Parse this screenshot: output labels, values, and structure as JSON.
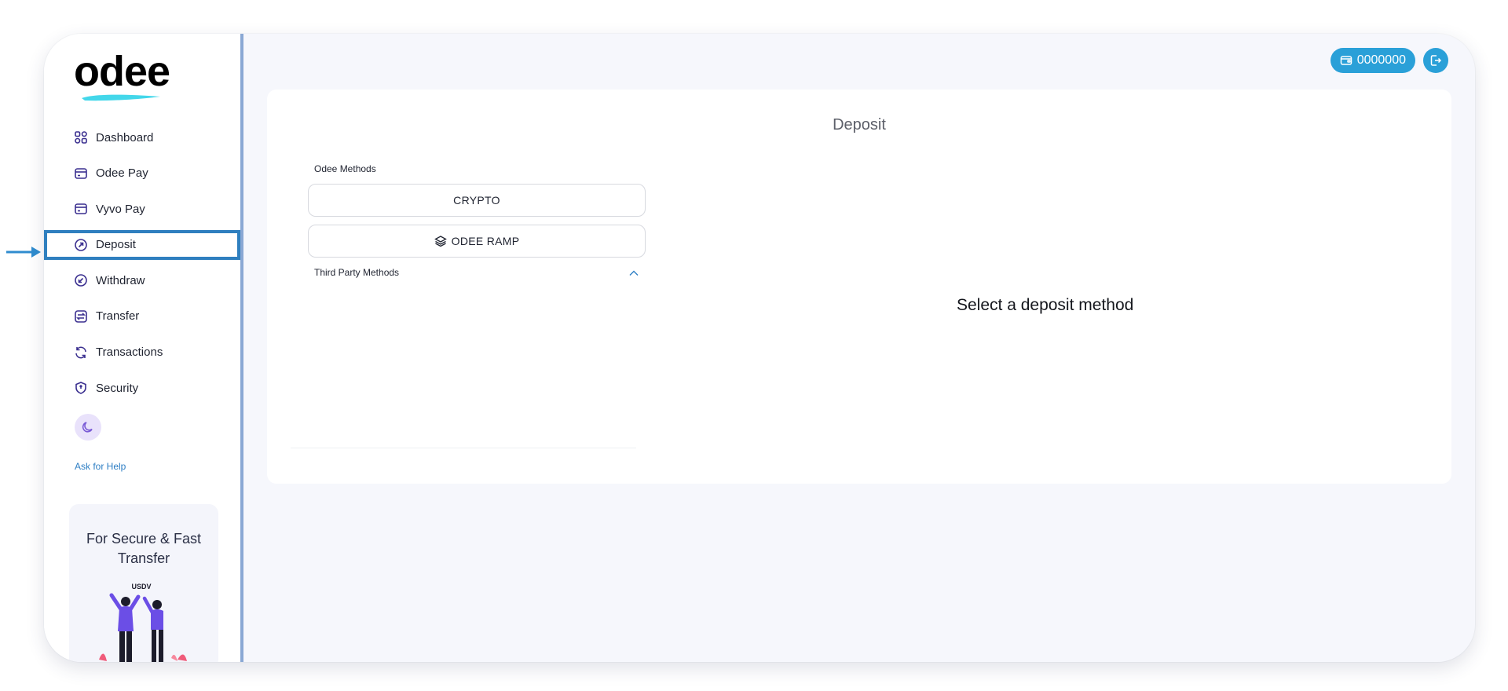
{
  "app": {
    "logo_text": "odee"
  },
  "sidebar": {
    "items": [
      {
        "label": "Dashboard",
        "icon": "grid-icon"
      },
      {
        "label": "Odee Pay",
        "icon": "card-icon"
      },
      {
        "label": "Vyvo Pay",
        "icon": "card-icon"
      },
      {
        "label": "Deposit",
        "icon": "arrow-up-circle-icon",
        "active": true
      },
      {
        "label": "Withdraw",
        "icon": "arrow-down-circle-icon"
      },
      {
        "label": "Transfer",
        "icon": "transfer-icon"
      },
      {
        "label": "Transactions",
        "icon": "refresh-icon"
      },
      {
        "label": "Security",
        "icon": "shield-icon"
      }
    ],
    "theme_toggle_icon": "moon-icon",
    "help_link": "Ask for Help",
    "promo": {
      "title": "For Secure & Fast Transfer",
      "art_label": "USDV"
    }
  },
  "topbar": {
    "balance": "0000000",
    "balance_icon": "wallet-icon",
    "logout_icon": "logout-icon"
  },
  "deposit": {
    "title": "Deposit",
    "odee_methods_label": "Odee Methods",
    "methods": [
      {
        "label": "CRYPTO"
      },
      {
        "label": "ODEE RAMP",
        "icon": "layers-icon"
      }
    ],
    "third_party_label": "Third Party Methods",
    "placeholder": "Select a deposit method"
  },
  "colors": {
    "accent": "#2aa0d8",
    "active_outline": "#2f7fbf",
    "icon_purple": "#3a2f8f",
    "background": "#f6f7fc"
  }
}
